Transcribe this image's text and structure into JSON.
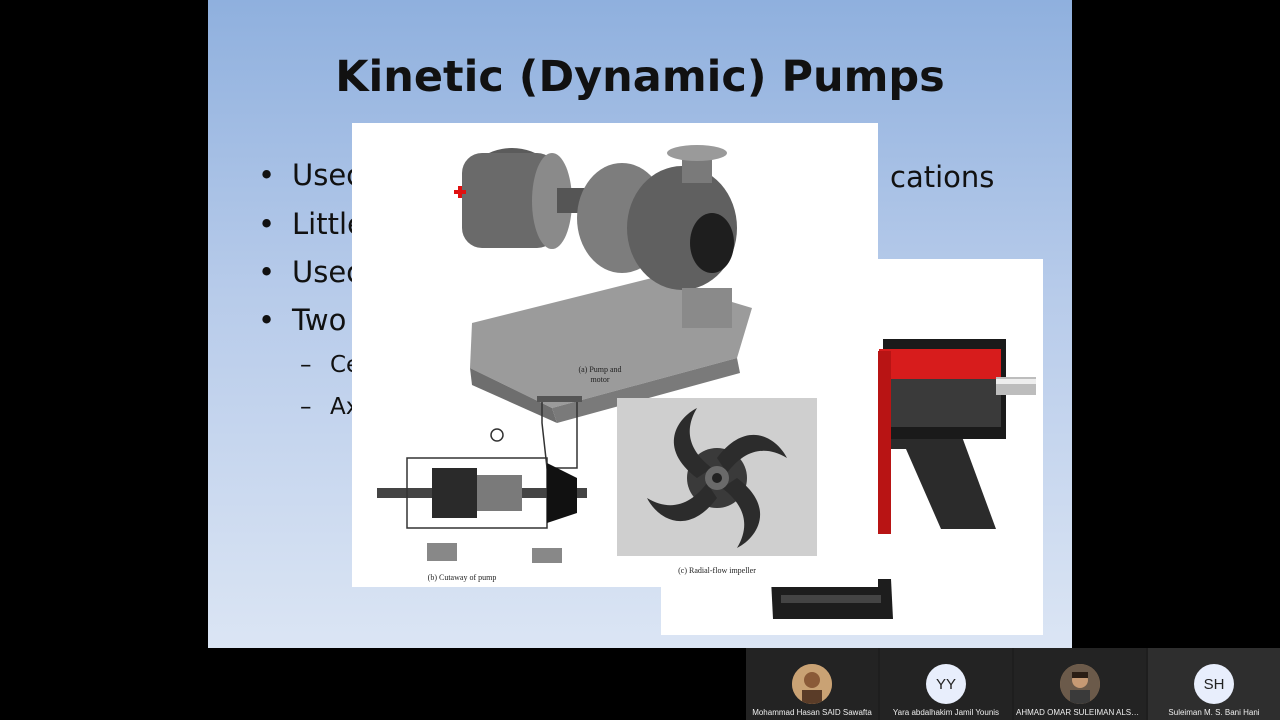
{
  "slide": {
    "title": "Kinetic (Dynamic) Pumps",
    "bullets": [
      "Usec",
      "Little",
      "Usec",
      "Two"
    ],
    "bullet_tail": "cations",
    "sub_bullets": [
      "Ce",
      "Ax"
    ],
    "bullet_symbol": "•",
    "dash_symbol": "–"
  },
  "figure": {
    "captions": {
      "a": "(a) Pump and motor",
      "b": "(b) Cutaway of pump",
      "c": "(c) Radial-flow impeller"
    }
  },
  "participants": [
    {
      "name": "Mohammad Hasan SAID Sawafta",
      "initials": "",
      "photo": true
    },
    {
      "name": "Yara abdalhakim Jamil Younis",
      "initials": "YY",
      "photo": false
    },
    {
      "name": "AHMAD OMAR SULEIMAN ALSHAR...",
      "initials": "",
      "photo": true
    },
    {
      "name": "Suleiman M. S. Bani Hani",
      "initials": "SH",
      "photo": false
    }
  ],
  "colors": {
    "accent_red": "#e01010",
    "cutaway_red": "#d71c1c"
  }
}
